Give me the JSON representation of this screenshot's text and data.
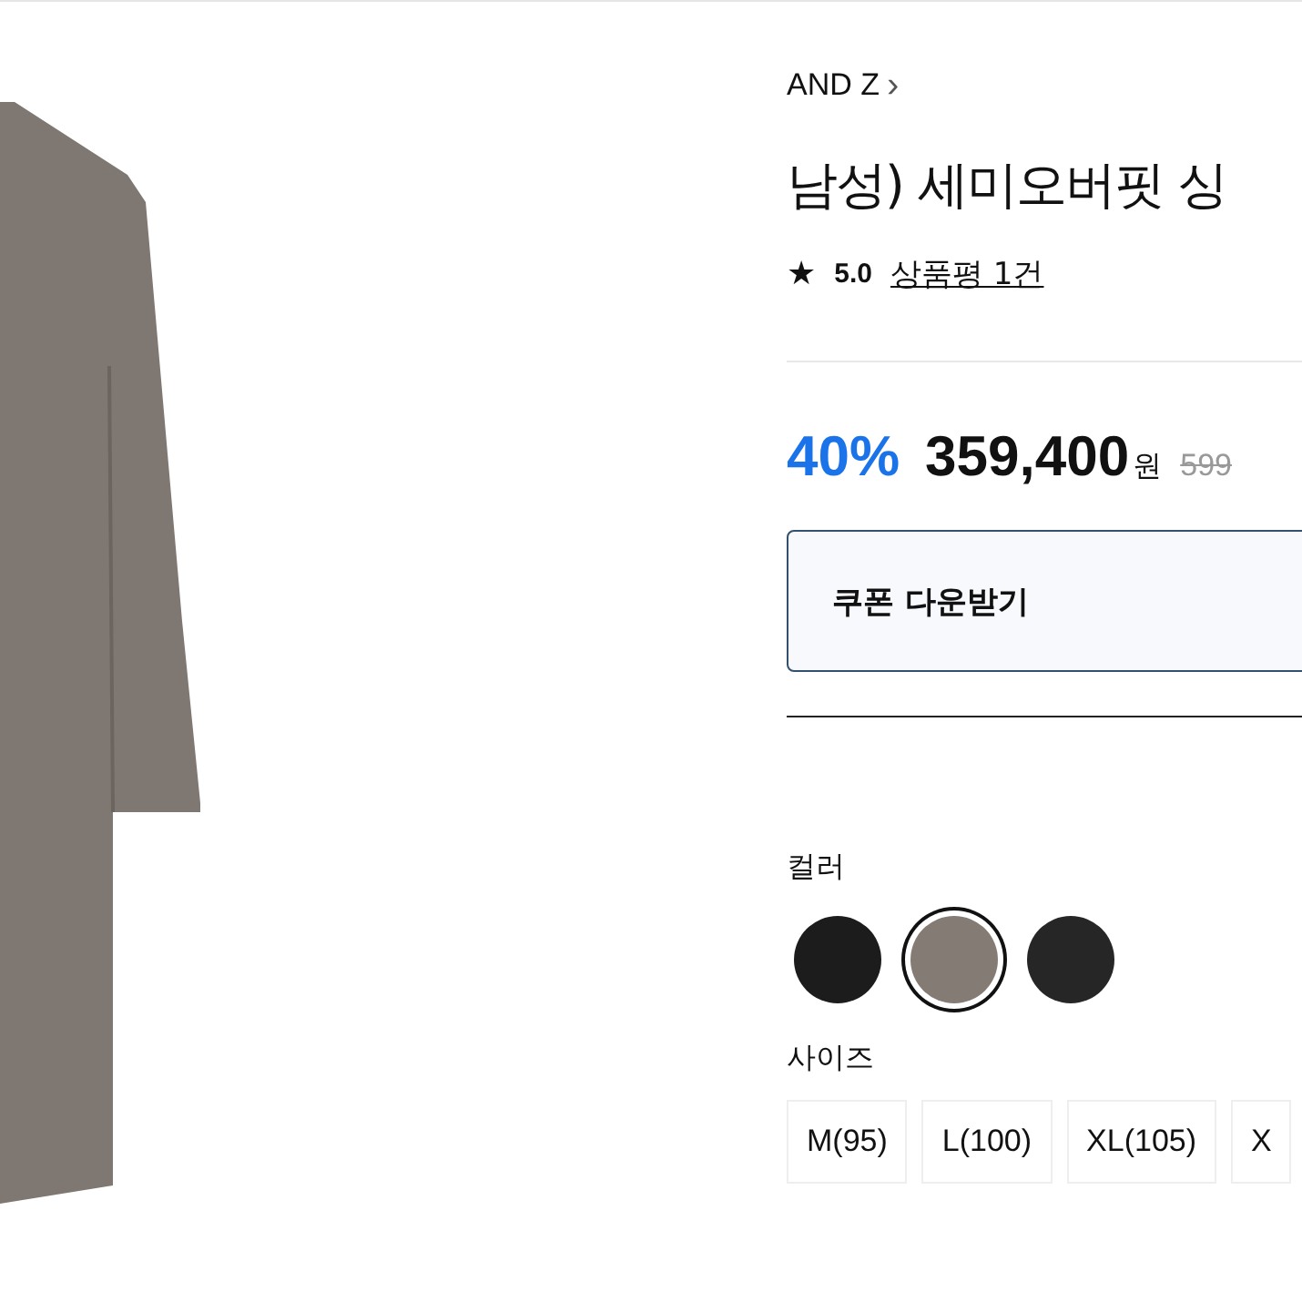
{
  "brand": {
    "name": "AND Z",
    "chevron": "›"
  },
  "title": "남성) 세미오버핏 싱",
  "rating": {
    "star": "★",
    "score": "5.0",
    "reviews": "상품평 1건"
  },
  "price": {
    "discount": "40%",
    "amount": "359,400",
    "unit": "원",
    "original": "599"
  },
  "coupon": {
    "label": "쿠폰 다운받기"
  },
  "color_option": {
    "label": "컬러",
    "swatches": [
      {
        "color": "#1c1c1c",
        "selected": false
      },
      {
        "color": "#857b75",
        "selected": true
      },
      {
        "color": "#262626",
        "selected": false
      }
    ]
  },
  "size_option": {
    "label": "사이즈",
    "sizes": [
      {
        "label": "M(95)"
      },
      {
        "label": "L(100)"
      },
      {
        "label": "XL(105)"
      },
      {
        "label": "X"
      }
    ]
  }
}
